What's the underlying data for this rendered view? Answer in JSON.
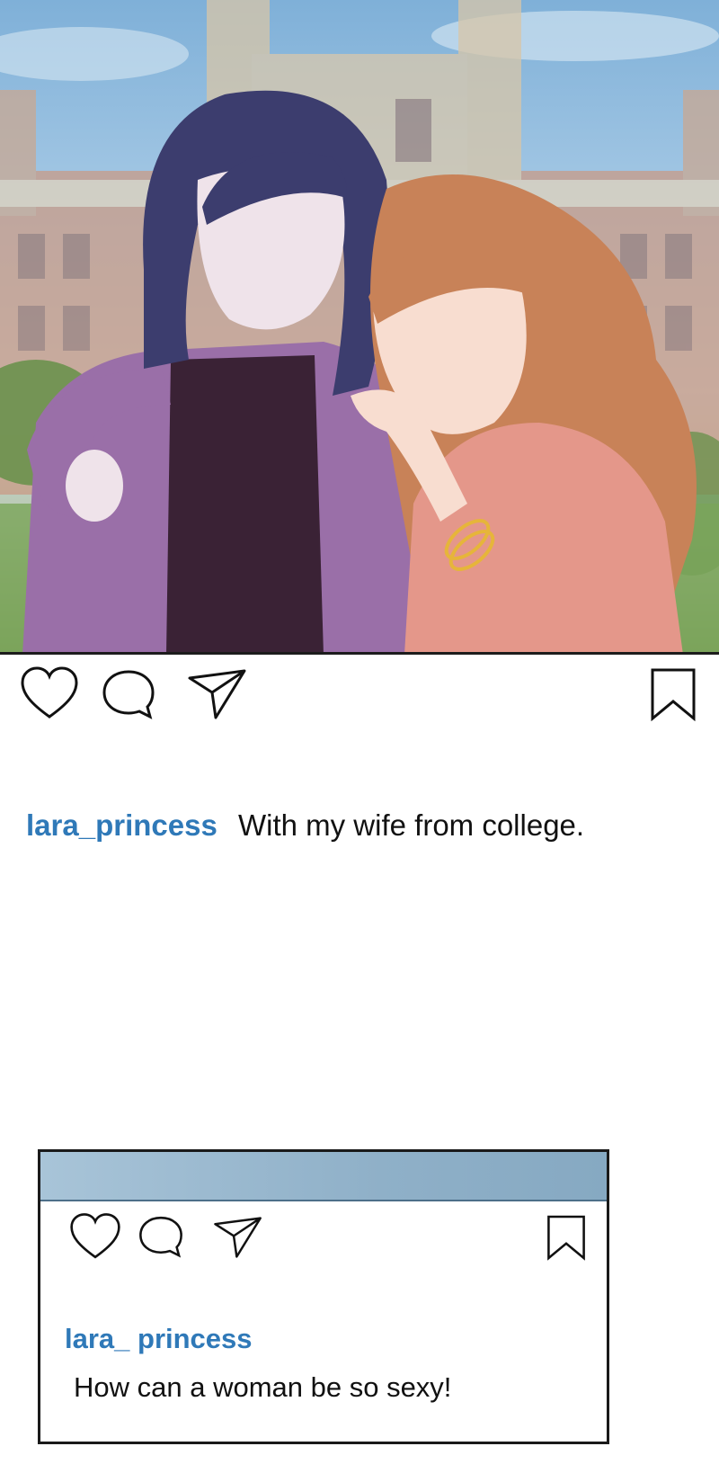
{
  "post": {
    "image_alt": "Two women posing together in front of a college building",
    "username": "lara_princess",
    "caption": "With my wife from college."
  },
  "icons": {
    "like": "heart-icon",
    "comment": "comment-bubble-icon",
    "share": "paper-plane-icon",
    "save": "bookmark-icon"
  },
  "mini_post": {
    "username": "lara_ princess",
    "caption": "How can a woman be so sexy!"
  },
  "colors": {
    "username": "#2f79b8",
    "text": "#111111",
    "border": "#1a1a1a"
  }
}
